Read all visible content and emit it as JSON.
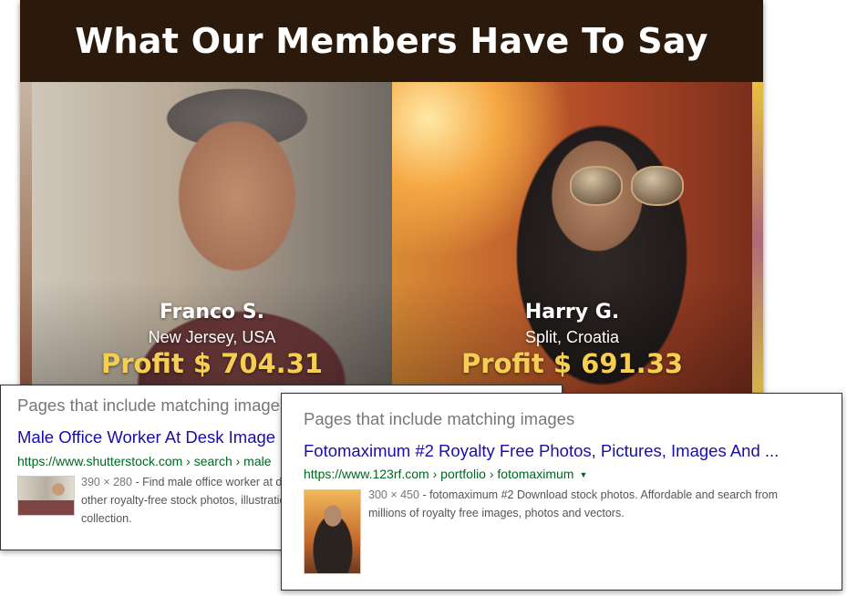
{
  "testimonial": {
    "title": "What Our Members Have To Say",
    "members": [
      {
        "name": "Franco S.",
        "location": "New Jersey, USA",
        "profit": "Profit $ 704.31"
      },
      {
        "name": "Harry G.",
        "location": "Split, Croatia",
        "profit": "Profit $ 691.33"
      }
    ],
    "profit_color": "#f6cf52",
    "header_bg": "#2b1a0c"
  },
  "search_results": [
    {
      "heading": "Pages that include matching images",
      "title": "Male Office Worker At Desk Image",
      "url": "https://www.shutterstock.com › search › male",
      "dimensions": "390 × 280",
      "description_lines": [
        " - Find male office worker at desk stock images in HD and millions of",
        "other royalty-free stock photos, illustrations and vectors in the Shutterstock",
        "collection."
      ]
    },
    {
      "heading": "Pages that include matching images",
      "title": "Fotomaximum #2 Royalty Free Photos, Pictures, Images And ...",
      "url": "https://www.123rf.com › portfolio › fotomaximum",
      "url_dropdown_icon": "caret-down-icon",
      "dimensions": "300 × 450",
      "description_lines": [
        " - fotomaximum #2 Download stock photos. Affordable and search from",
        "millions of royalty free images, photos and vectors."
      ]
    }
  ],
  "colors": {
    "link_title": "#1a0dab",
    "url_green": "#006621",
    "snippet_gray": "#545454"
  }
}
